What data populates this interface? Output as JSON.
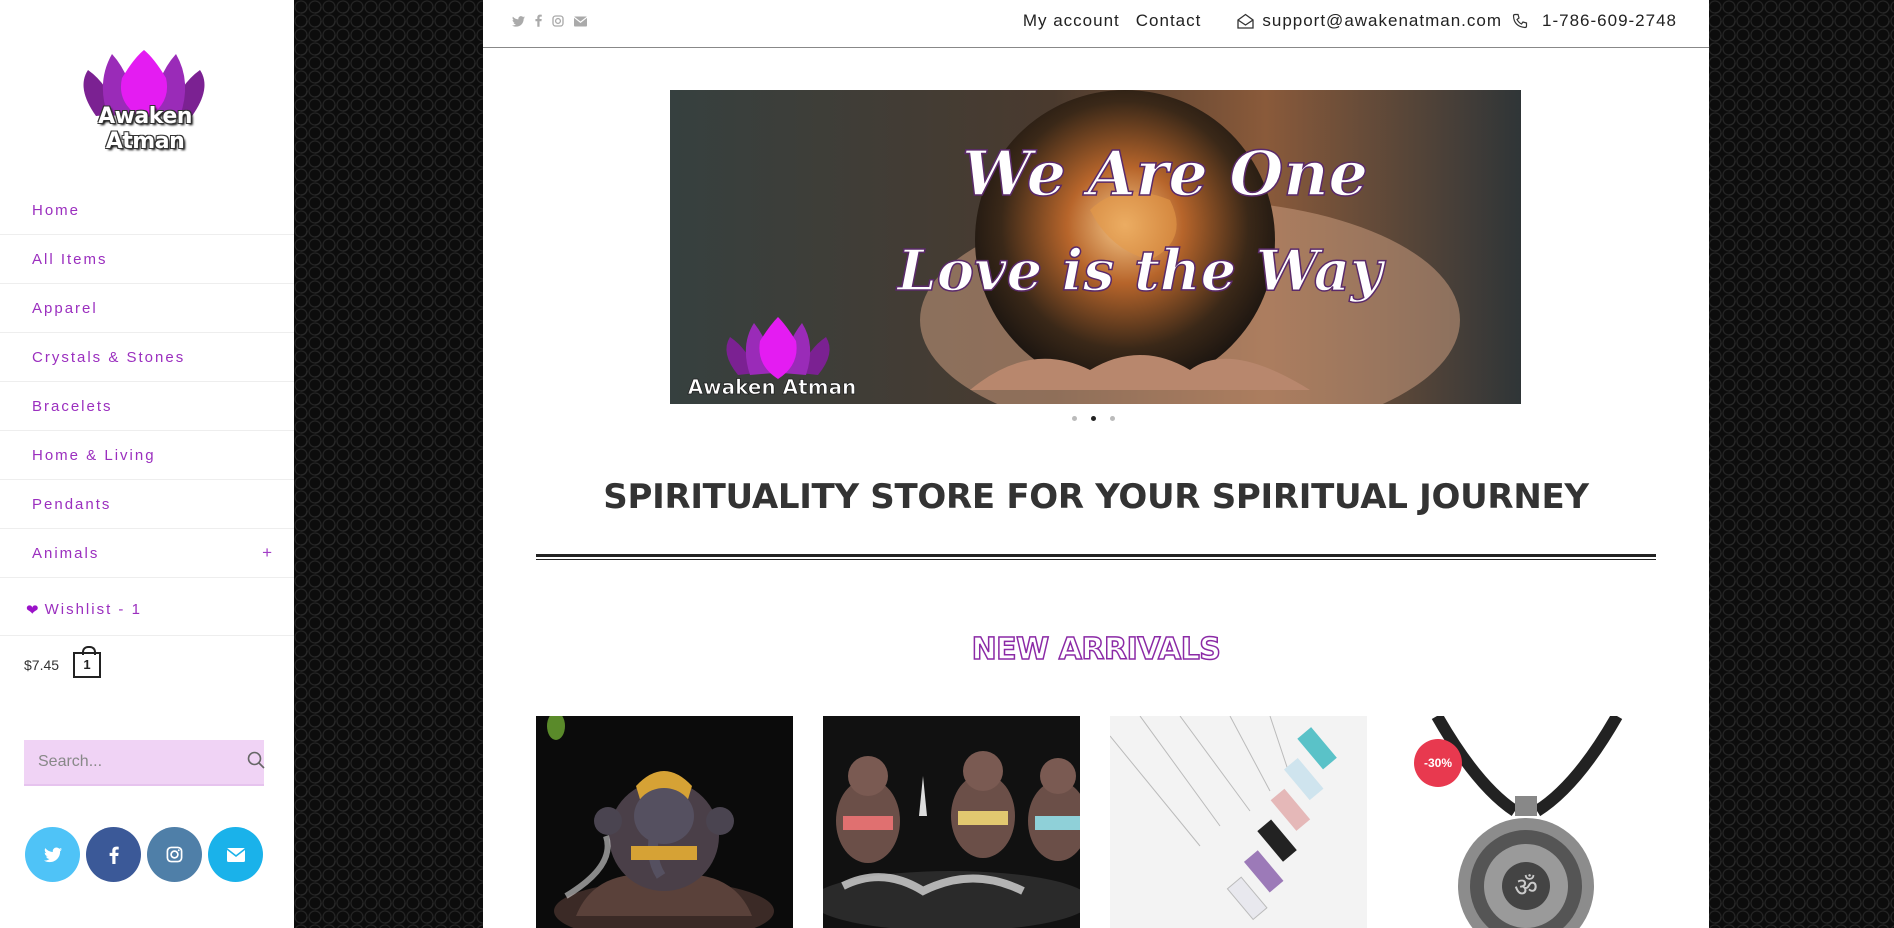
{
  "brand": {
    "name": "Awaken Atman",
    "colors": {
      "accent": "#9b2fbf",
      "lotus": "#d12ef0",
      "sale": "#e8394f"
    }
  },
  "sidebar": {
    "nav": [
      {
        "label": "Home"
      },
      {
        "label": "All Items"
      },
      {
        "label": "Apparel"
      },
      {
        "label": "Crystals & Stones"
      },
      {
        "label": "Bracelets"
      },
      {
        "label": "Home & Living"
      },
      {
        "label": "Pendants"
      },
      {
        "label": "Animals",
        "expand": "+"
      }
    ],
    "wishlist": {
      "icon": "heart-icon",
      "label": "Wishlist - 1"
    },
    "cart": {
      "price": "$7.45",
      "count": "1"
    },
    "search": {
      "placeholder": "Search...",
      "icon": "search-icon"
    },
    "socials": [
      {
        "icon": "twitter-icon",
        "color": "#4fc3f7"
      },
      {
        "icon": "facebook-icon",
        "color": "#3b5998"
      },
      {
        "icon": "instagram-icon",
        "color": "#4f7fa8"
      },
      {
        "icon": "envelope-icon",
        "color": "#1ab2ea"
      }
    ]
  },
  "topbar": {
    "icons": [
      "twitter-icon",
      "facebook-icon",
      "instagram-icon",
      "envelope-icon"
    ],
    "my_account": "My account",
    "contact": "Contact",
    "email": "support@awakenatman.com",
    "phone": "1-786-609-2748"
  },
  "slider": {
    "line1": "We Are One",
    "line2": "Love is the Way",
    "logo_text": "Awaken Atman",
    "slides": 3,
    "active_slide": 2
  },
  "headline": "SPIRITUALITY STORE FOR YOUR SPIRITUAL JOURNEY",
  "section_title": "NEW ARRIVALS",
  "products": [
    {
      "image": "ganesha-incense-burner"
    },
    {
      "image": "buddha-backflow-incense"
    },
    {
      "image": "crystal-point-necklaces"
    },
    {
      "image": "om-mandala-pendant",
      "badge": "-30%"
    }
  ]
}
